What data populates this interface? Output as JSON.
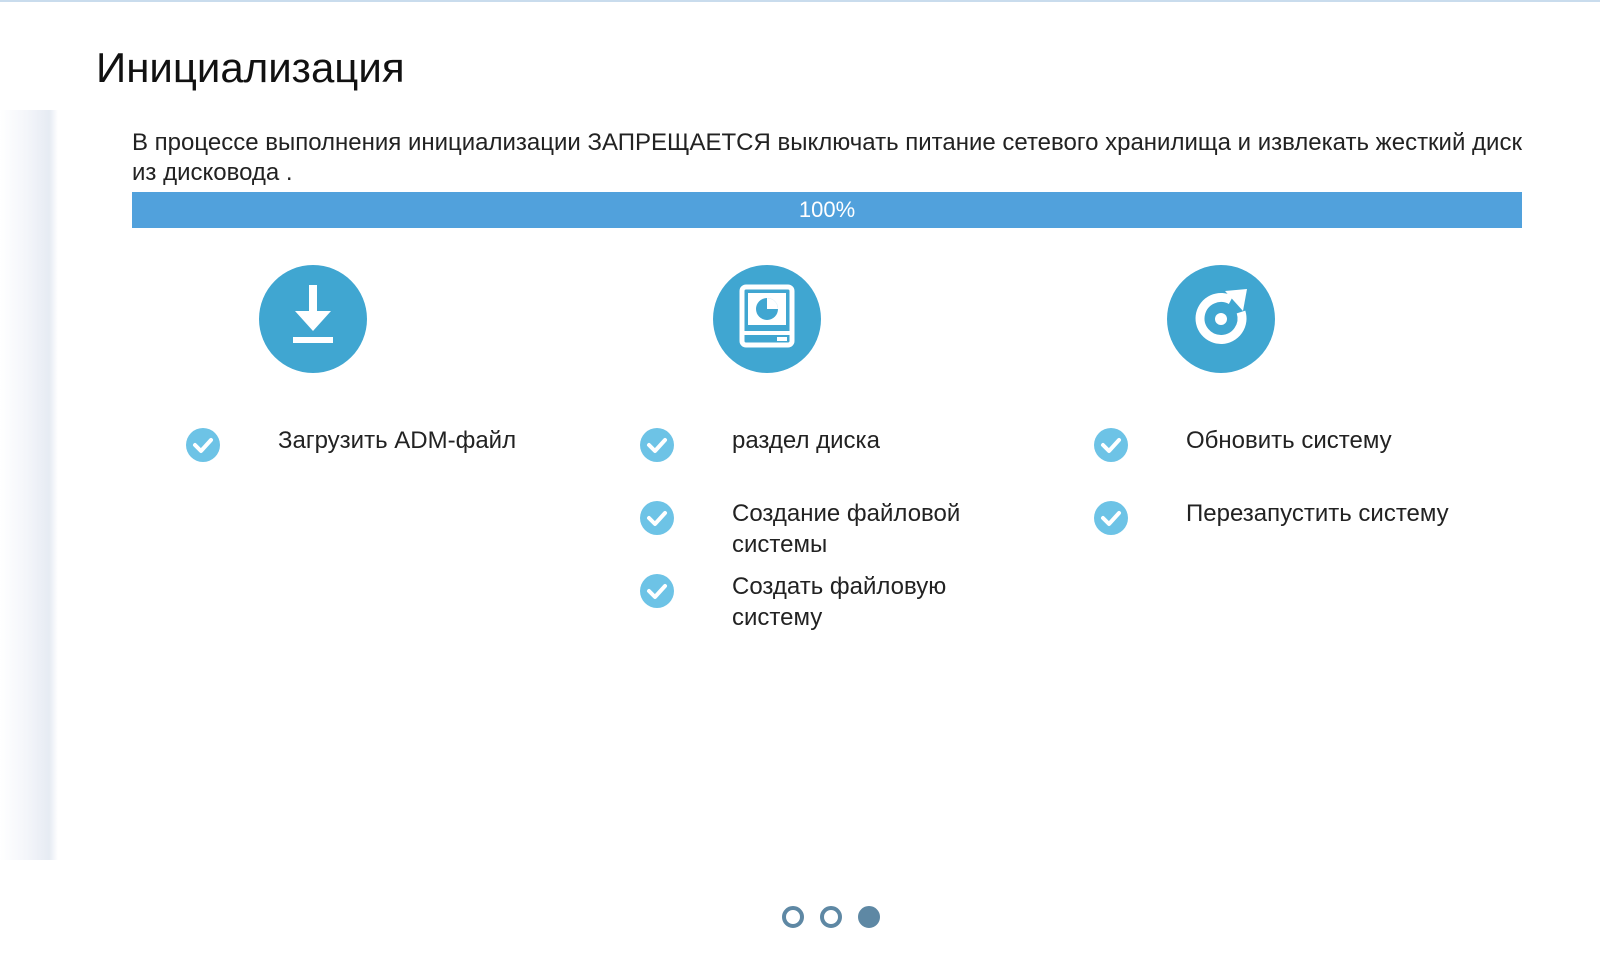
{
  "title": "Инициализация",
  "warning": "В процессе выполнения инициализации ЗАПРЕЩАЕТСЯ выключать питание сетевого хранилища и извлекать жесткий диск из дисковода .",
  "progress": {
    "percent": 100,
    "label": "100%",
    "color": "#51a1dc"
  },
  "steps": [
    {
      "icon": "download-icon",
      "tasks": [
        {
          "label": "Загрузить ADM-файл",
          "done": true
        }
      ]
    },
    {
      "icon": "disk-partition-icon",
      "tasks": [
        {
          "label": "раздел диска",
          "done": true
        },
        {
          "label": "Создание файловой системы",
          "done": true
        },
        {
          "label": "Создать файловую систему",
          "done": true
        }
      ]
    },
    {
      "icon": "refresh-icon",
      "tasks": [
        {
          "label": "Обновить систему",
          "done": true
        },
        {
          "label": "Перезапустить систему",
          "done": true
        }
      ]
    }
  ],
  "pager": {
    "count": 3,
    "active_index": 2
  },
  "colors": {
    "icon_circle": "#40a6d1",
    "check_circle": "#6dc3e6",
    "pager": "#5e88a4"
  }
}
